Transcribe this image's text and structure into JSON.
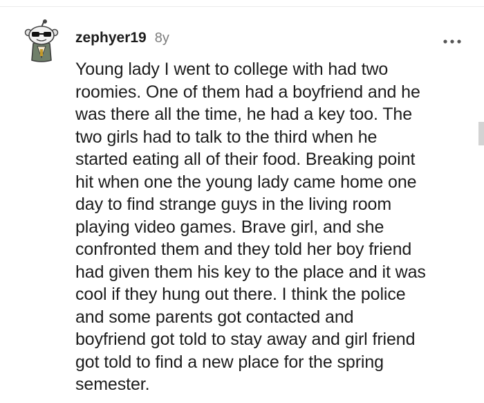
{
  "comment": {
    "username": "zephyer19",
    "age": "8y",
    "body": "Young lady I went to college with had two\nroomies. One of them had a boyfriend and he\nwas there all the time, he had a key too. The\ntwo girls had to talk to the third when he\nstarted eating all of their food. Breaking point\nhit when one the young lady came home one\nday to find strange guys in the living room\nplaying video games. Brave girl, and she\nconfronted them and they told her boy friend\nhad given them his key to the place and it was\ncool if they hung out there. I think the police\nand some parents got contacted and\nboyfriend got told to stay away and girl friend\ngot told to find a new place for the spring\nsemester."
  },
  "icons": {
    "avatar": "snoo-avatar-icon",
    "more": "more-options-icon"
  },
  "colors": {
    "text": "#1c1c1c",
    "meta": "#7c7c7c",
    "avatar_bg": "#d9d9d9"
  }
}
